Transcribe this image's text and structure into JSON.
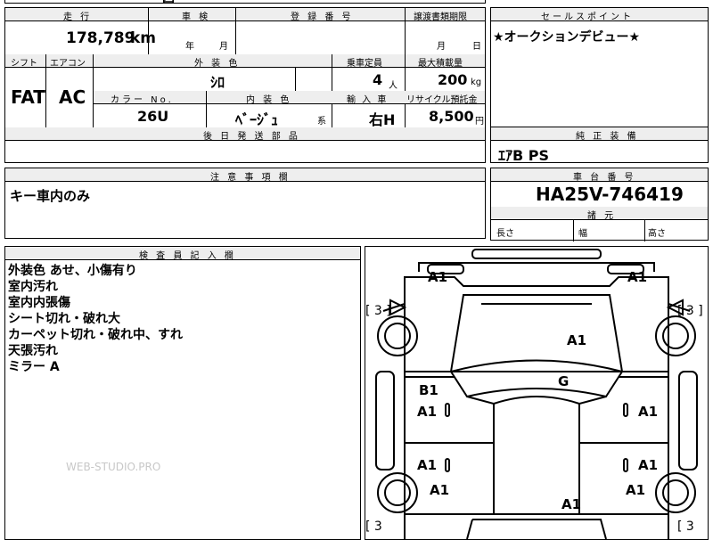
{
  "top_cut": "四",
  "header_row": {
    "mileage_label": "走 行",
    "inspection_label": "車 検",
    "registration_label": "登 録 番 号",
    "transfer_docs_label": "譲渡書類期限",
    "sales_point_label": "セールスポイント"
  },
  "values_row": {
    "mileage": "178,789",
    "mileage_unit": "km",
    "inspection_year": "年",
    "inspection_month": "月",
    "transfer_month": "月",
    "transfer_day": "日",
    "sales_point": "★オークションデビュー★"
  },
  "spec_labels": {
    "shift": "シフト",
    "ac": "エアコン",
    "exterior_color": "外 装 色",
    "capacity": "乗車定員",
    "max_load": "最大積載量",
    "color_no": "カラー No.",
    "interior_color": "内 装 色",
    "import": "輸 入 車",
    "recycle": "リサイクル預託金",
    "later_parts": "後 日 発 送 部 品",
    "genuine_equipment": "純 正 装 備"
  },
  "spec_values": {
    "shift": "FAT",
    "ac": "AC",
    "exterior_color": "ｼﾛ",
    "capacity": "4",
    "capacity_unit": "人",
    "max_load": "200",
    "max_load_unit": "kg",
    "color_no": "26U",
    "interior_color": "ﾍﾞｰｼﾞｭ",
    "interior_suffix": "系",
    "import": "右H",
    "recycle": "8,500",
    "recycle_unit": "円",
    "genuine_equipment": "ｴｱB PS"
  },
  "caution": {
    "label": "注 意 事 項 欄",
    "text": "キー車内のみ"
  },
  "chassis": {
    "label": "車 台 番 号",
    "value": "HA25V-746419",
    "dimensions_label": "諸 元",
    "length": "長さ",
    "width": "幅",
    "height": "高さ"
  },
  "inspector": {
    "label": "検 査 員 記 入 欄",
    "notes": [
      "外装色 あせ、小傷有り",
      "室内汚れ",
      "室内内張傷",
      "シート切れ・破れ大",
      "カーペット切れ・破れ中、すれ",
      "天張汚れ",
      "ミラー A"
    ]
  },
  "diagram": {
    "marks": {
      "front_left": "A1",
      "front_right": "A1",
      "tire_fl": "[ 3 ]",
      "tire_fr": "[ 3 ]",
      "tire_rl": "[ 3",
      "tire_rr": "[ 3",
      "hood": "A1",
      "windshield": "G",
      "door_fl_top": "B1",
      "door_fl": "A1",
      "door_fr": "A1",
      "door_rl": "A1",
      "door_rr": "A1",
      "rear_left": "A1",
      "rear_right": "A1",
      "rear": "A1"
    }
  },
  "watermark": "WEB-STUDIO.PRO"
}
